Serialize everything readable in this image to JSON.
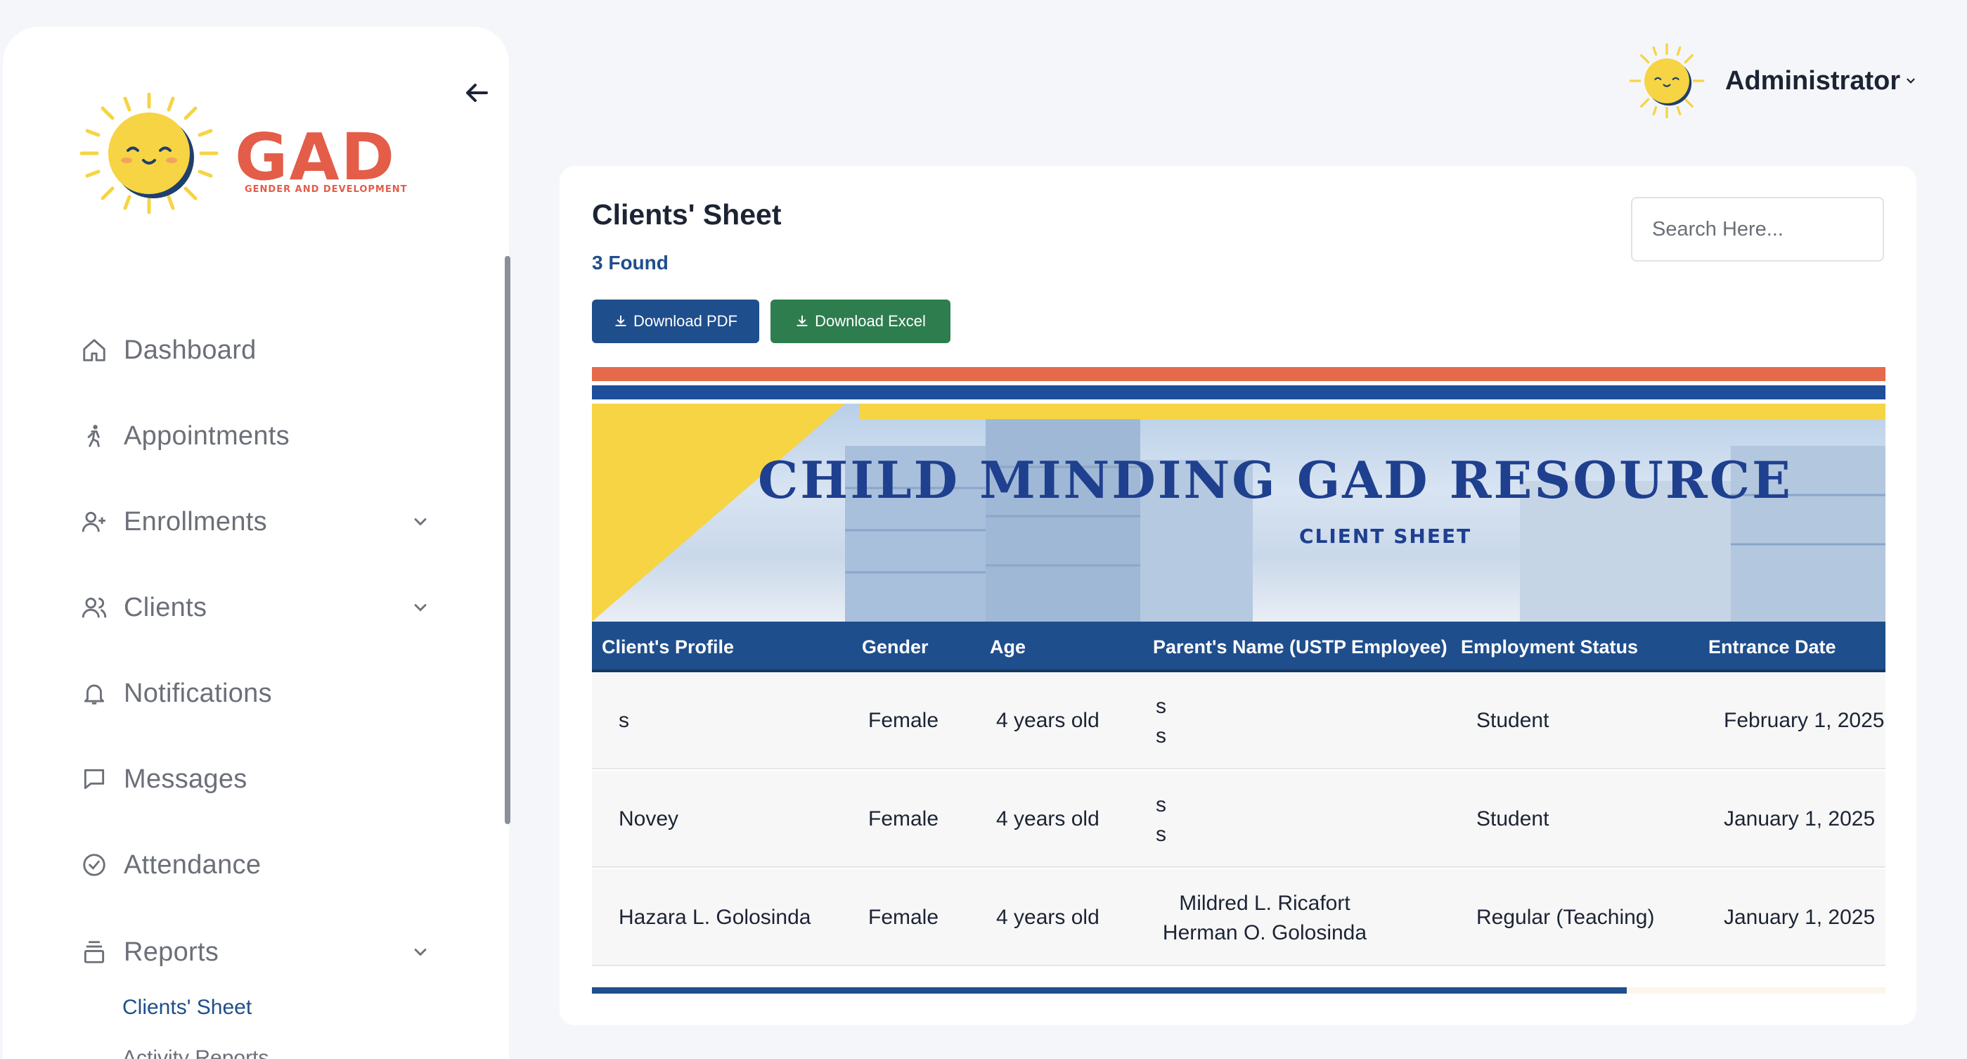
{
  "app": {
    "logo_text": "GAD",
    "logo_subtitle": "GENDER AND DEVELOPMENT"
  },
  "sidebar": {
    "items": [
      {
        "label": "Dashboard",
        "icon": "home-icon"
      },
      {
        "label": "Appointments",
        "icon": "walking-person-icon"
      },
      {
        "label": "Enrollments",
        "icon": "user-plus-icon",
        "expandable": true
      },
      {
        "label": "Clients",
        "icon": "users-icon",
        "expandable": true
      },
      {
        "label": "Notifications",
        "icon": "bell-icon"
      },
      {
        "label": "Messages",
        "icon": "chat-bubble-icon"
      },
      {
        "label": "Attendance",
        "icon": "check-circle-icon"
      },
      {
        "label": "Reports",
        "icon": "stack-icon",
        "expandable": true,
        "expanded": true
      }
    ],
    "reports_subitems": [
      {
        "label": "Clients' Sheet",
        "active": true
      },
      {
        "label": "Activity Reports",
        "active": false
      }
    ]
  },
  "header": {
    "user_name": "Administrator"
  },
  "main": {
    "title": "Clients' Sheet",
    "found_text": "3 Found",
    "search_placeholder": "Search Here...",
    "download_pdf_label": "Download PDF",
    "download_excel_label": "Download Excel",
    "banner_title": "CHILD MINDING GAD RESOURCE",
    "banner_subtitle": "CLIENT SHEET",
    "table": {
      "columns": [
        "Client's Profile",
        "Gender",
        "Age",
        "Parent's Name (USTP Employee)",
        "Employment Status",
        "Entrance Date"
      ],
      "rows": [
        {
          "profile": "s",
          "gender": "Female",
          "age": "4 years old",
          "parent1": "s",
          "parent2": "s",
          "status": "Student",
          "date": "February 1, 2025"
        },
        {
          "profile": "Novey",
          "gender": "Female",
          "age": "4 years old",
          "parent1": "s",
          "parent2": "s",
          "status": "Student",
          "date": "January 1, 2025"
        },
        {
          "profile": "Hazara L. Golosinda",
          "gender": "Female",
          "age": "4 years old",
          "parent1": "Mildred L. Ricafort",
          "parent2": "Herman O. Golosinda",
          "status": "Regular (Teaching)",
          "date": "January 1, 2025"
        }
      ]
    }
  },
  "colors": {
    "primary_blue": "#1f4e8c",
    "excel_green": "#2e7d4f",
    "brand_red": "#e35d49",
    "sun_yellow": "#f6d443"
  }
}
